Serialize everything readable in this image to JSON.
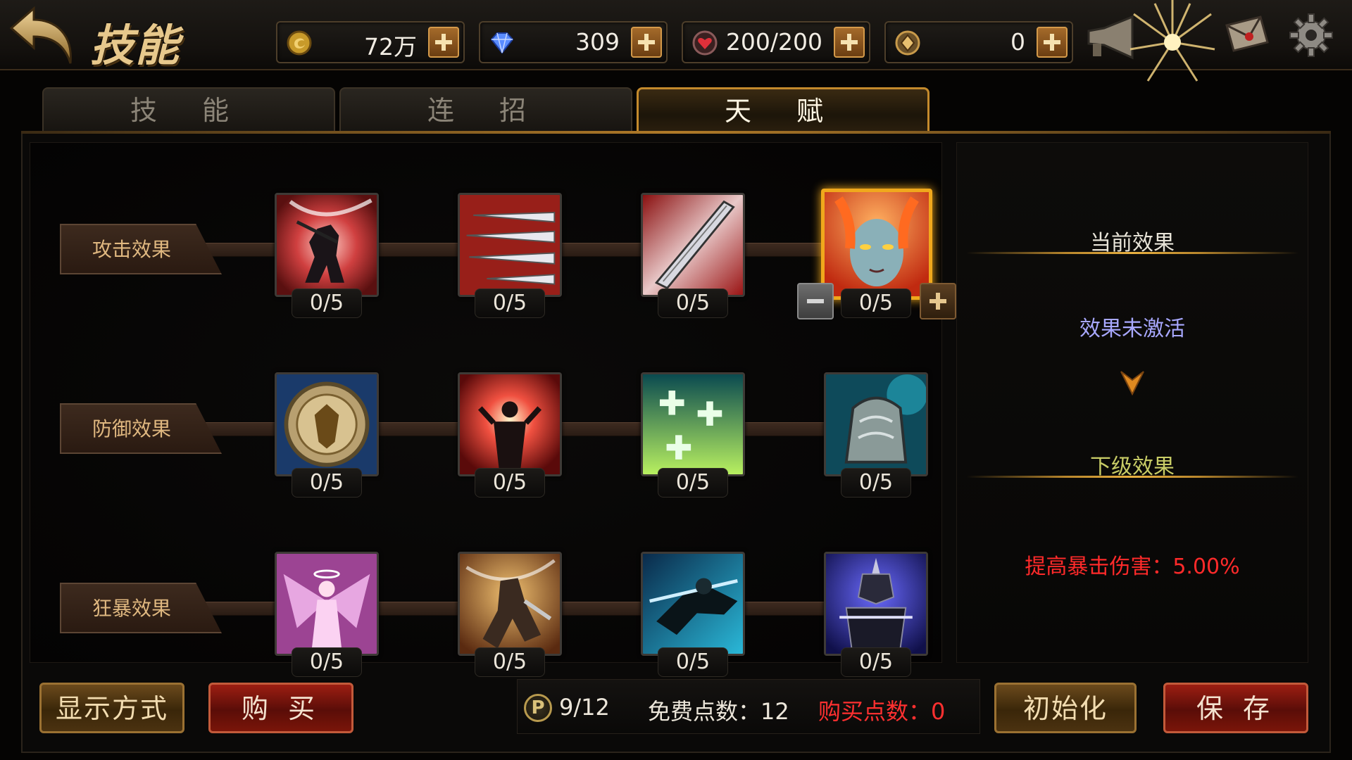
{
  "header": {
    "title": "技能",
    "resources": [
      {
        "name": "gold",
        "icon": "gold-coin-icon",
        "value": "72万"
      },
      {
        "name": "diamond",
        "icon": "diamond-icon",
        "value": "309"
      },
      {
        "name": "stamina",
        "icon": "stamina-heart-icon",
        "value": "200/200"
      },
      {
        "name": "token",
        "icon": "token-icon",
        "value": "0"
      }
    ]
  },
  "tabs": [
    {
      "label": "技 能",
      "active": false
    },
    {
      "label": "连 招",
      "active": false
    },
    {
      "label": "天 赋",
      "active": true
    }
  ],
  "talent_rows": [
    {
      "label": "攻击效果",
      "nodes": [
        {
          "icon": "shadow-warrior-icon",
          "count": "0/5"
        },
        {
          "icon": "triple-blades-icon",
          "count": "0/5"
        },
        {
          "icon": "sword-slash-icon",
          "count": "0/5"
        },
        {
          "icon": "fire-maiden-icon",
          "count": "0/5",
          "selected": true
        }
      ]
    },
    {
      "label": "防御效果",
      "nodes": [
        {
          "icon": "round-shield-icon",
          "count": "0/5"
        },
        {
          "icon": "power-burst-icon",
          "count": "0/5"
        },
        {
          "icon": "healing-crosses-icon",
          "count": "0/5"
        },
        {
          "icon": "armored-gauntlet-icon",
          "count": "0/5"
        }
      ]
    },
    {
      "label": "狂暴效果",
      "nodes": [
        {
          "icon": "winged-angel-icon",
          "count": "0/5"
        },
        {
          "icon": "berserker-icon",
          "count": "0/5"
        },
        {
          "icon": "dark-rider-icon",
          "count": "0/5"
        },
        {
          "icon": "dark-knight-icon",
          "count": "0/5"
        }
      ]
    }
  ],
  "effects": {
    "current_title": "当前效果",
    "current_text": "效果未激活",
    "next_title": "下级效果",
    "next_text": "提高暴击伤害：5.00%"
  },
  "footer": {
    "display_mode_label": "显示方式",
    "buy_label": "购 买",
    "points_icon_text": "P",
    "points": "9/12",
    "free_points": "免费点数：12",
    "bought_points": "购买点数：0",
    "reset_label": "初始化",
    "save_label": "保 存"
  },
  "colors": {
    "accent_gold": "#f0a81c",
    "effect_inactive": "#a8a8ff",
    "next_title": "#c8cc66",
    "next_text": "#ff2a2a",
    "bought_points": "#ff3030"
  }
}
